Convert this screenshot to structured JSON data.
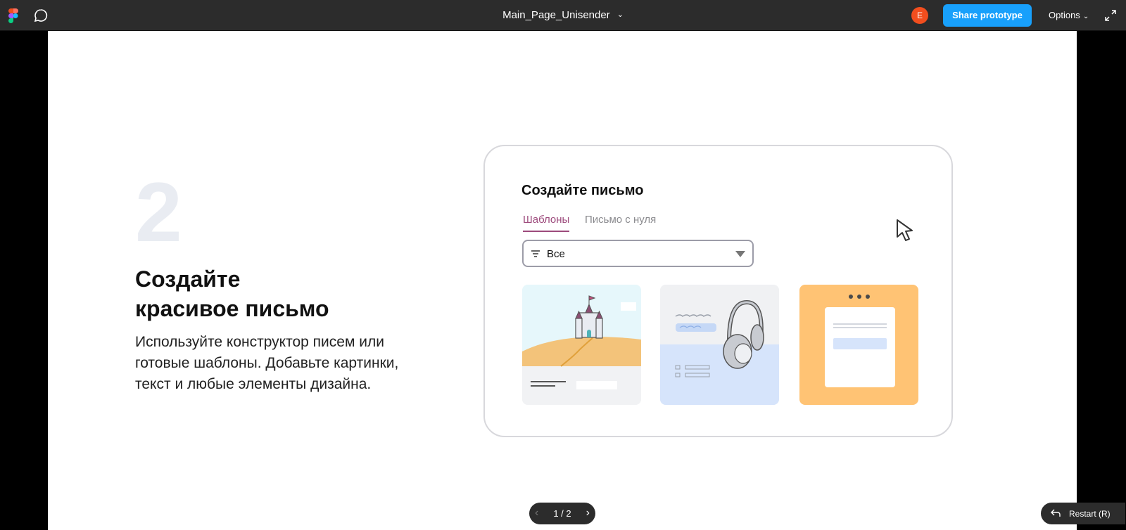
{
  "toolbar": {
    "file_name": "Main_Page_Unisender",
    "avatar_initial": "E",
    "share_label": "Share prototype",
    "options_label": "Options"
  },
  "slide": {
    "step_number": "2",
    "heading_lines": [
      "Создайте",
      "красивое письмо"
    ],
    "description_lines": [
      "Используйте конструктор писем или",
      "готовые шаблоны. Добавьте картинки,",
      "текст и любые элементы дизайна."
    ]
  },
  "card": {
    "title": "Создайте письмо",
    "tabs": [
      {
        "label": "Шаблоны",
        "active": true
      },
      {
        "label": "Письмо с нуля",
        "active": false
      }
    ],
    "filter_value": "Все",
    "templates": [
      "castle-template",
      "headphones-template",
      "blank-window-template"
    ]
  },
  "pager": {
    "label": "1 / 2"
  },
  "restart": {
    "label": "Restart (R)"
  },
  "colors": {
    "toolbar_bg": "#2c2c2c",
    "share_button": "#18a0fb",
    "avatar": "#f24e1e",
    "accent_tab": "#9d4a7c",
    "tile_orange": "#ffc374",
    "tile_blue": "#d6e4fb"
  }
}
